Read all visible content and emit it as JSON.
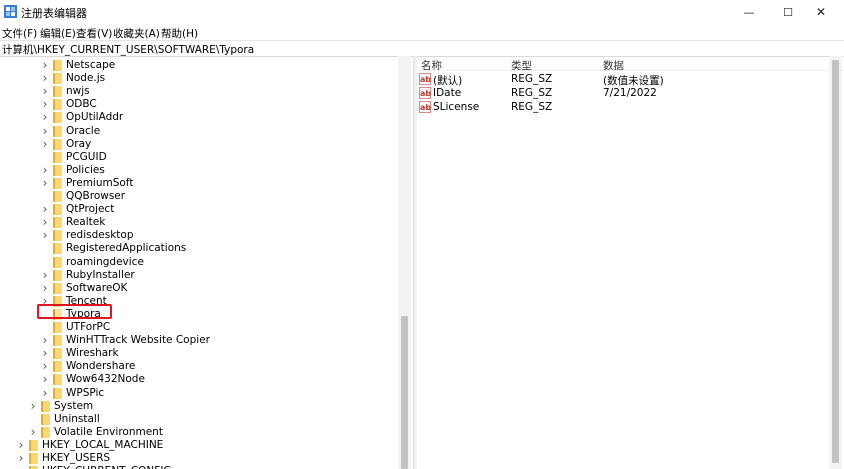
{
  "window": {
    "title": "注册表编辑器",
    "minimize_glyph": "—",
    "maximize_glyph": "☐",
    "close_glyph": "✕",
    "icon": "registry-icon"
  },
  "menu": [
    {
      "label": "文件(F)"
    },
    {
      "label": "编辑(E)"
    },
    {
      "label": "查看(V)"
    },
    {
      "label": "收藏夹(A)"
    },
    {
      "label": "帮助(H)"
    }
  ],
  "address": "计算机\\HKEY_CURRENT_USER\\SOFTWARE\\Typora",
  "tree": [
    {
      "label": "Netscape",
      "expander": true
    },
    {
      "label": "Node.js",
      "expander": true
    },
    {
      "label": "nwjs",
      "expander": true
    },
    {
      "label": "ODBC",
      "expander": true
    },
    {
      "label": "OpUtilAddr",
      "expander": true
    },
    {
      "label": "Oracle",
      "expander": true
    },
    {
      "label": "Oray",
      "expander": true
    },
    {
      "label": "PCGUID",
      "expander": false
    },
    {
      "label": "Policies",
      "expander": true
    },
    {
      "label": "PremiumSoft",
      "expander": true
    },
    {
      "label": "QQBrowser",
      "expander": false
    },
    {
      "label": "QtProject",
      "expander": true
    },
    {
      "label": "Realtek",
      "expander": true
    },
    {
      "label": "redisdesktop",
      "expander": true
    },
    {
      "label": "RegisteredApplications",
      "expander": false
    },
    {
      "label": "roamingdevice",
      "expander": false
    },
    {
      "label": "RubyInstaller",
      "expander": true
    },
    {
      "label": "SoftwareOK",
      "expander": true
    },
    {
      "label": "Tencent",
      "expander": true
    },
    {
      "label": "Typora",
      "expander": false,
      "selected": true
    },
    {
      "label": "UTForPC",
      "expander": false
    },
    {
      "label": "WinHTTrack Website Copier",
      "expander": true
    },
    {
      "label": "Wireshark",
      "expander": true
    },
    {
      "label": "Wondershare",
      "expander": true
    },
    {
      "label": "Wow6432Node",
      "expander": true
    },
    {
      "label": "WPSPic",
      "expander": true
    },
    {
      "label": "System",
      "expander": true
    },
    {
      "label": "Uninstall",
      "expander": false
    },
    {
      "label": "Volatile Environment",
      "expander": true
    },
    {
      "label": "HKEY_LOCAL_MACHINE",
      "expander": true
    },
    {
      "label": "HKEY_USERS",
      "expander": true
    },
    {
      "label": "HKEY_CURRENT_CONFIG",
      "expander": true
    }
  ],
  "columns": {
    "name": "名称",
    "type": "类型",
    "data": "数据"
  },
  "values": [
    {
      "name": "(默认)",
      "type": "REG_SZ",
      "data": "(数值未设置)",
      "icon": "ab"
    },
    {
      "name": "IDate",
      "type": "REG_SZ",
      "data": "7/21/2022",
      "icon": "ab"
    },
    {
      "name": "SLicense",
      "type": "REG_SZ",
      "data": "",
      "icon": "ab"
    }
  ],
  "colors": {
    "selection_outline": "#e0141e",
    "folder": "#f8d775"
  }
}
